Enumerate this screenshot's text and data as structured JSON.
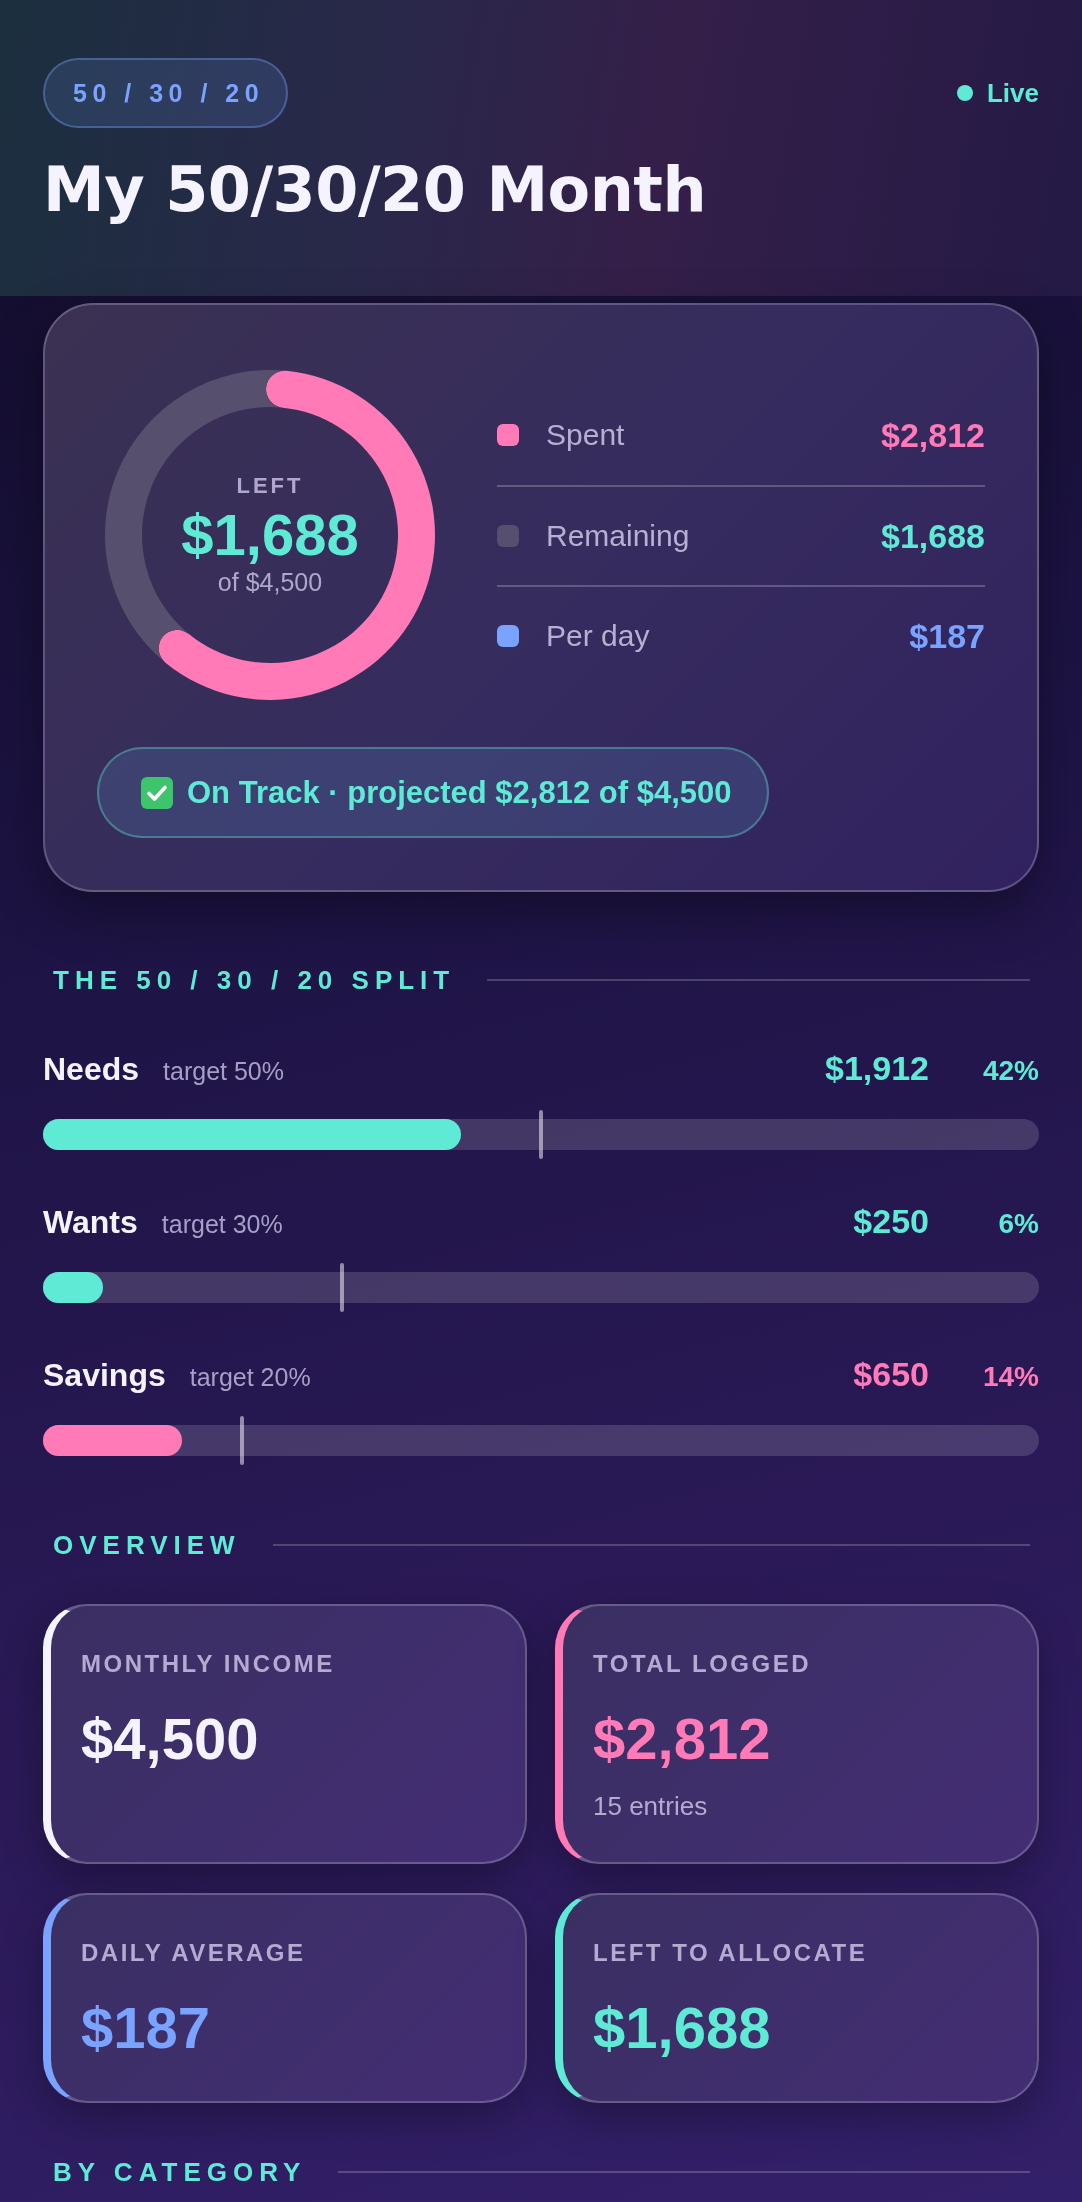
{
  "header": {
    "badge": "50 / 30 / 20",
    "status": "Live",
    "title": "My 50/30/20 Month"
  },
  "summary": {
    "ring": {
      "label": "LEFT",
      "value": "$1,688",
      "caption": "of $4,500",
      "chart_data": {
        "type": "donut",
        "values": [
          62.5,
          37.5
        ]
      }
    },
    "legend": [
      {
        "label": "Spent",
        "value": "$2,812",
        "color": "#ff7ab6",
        "kind": "spent"
      },
      {
        "label": "Remaining",
        "value": "$1,688",
        "color": "#56506e",
        "kind": "remaining"
      },
      {
        "label": "Per day",
        "value": "$187",
        "color": "#7aa2ff",
        "kind": "rate"
      }
    ],
    "badge": "On Track · projected $2,812 of $4,500"
  },
  "split": {
    "heading": "THE 50 / 30 / 20 SPLIT",
    "rows": [
      {
        "name": "Needs",
        "target": {
          "label": "target 50%",
          "level": 0.5
        },
        "amount": "$1,912",
        "percent": "42%",
        "level": 0.42,
        "color": "#5eead4"
      },
      {
        "name": "Wants",
        "target": {
          "label": "target 30%",
          "level": 0.3
        },
        "amount": "$250",
        "percent": "6%",
        "level": 0.06,
        "color": "#5eead4"
      },
      {
        "name": "Savings",
        "target": {
          "label": "target 20%",
          "level": 0.2
        },
        "amount": "$650",
        "percent": "14%",
        "level": 0.14,
        "color": "#ff7ab6"
      }
    ]
  },
  "overview": {
    "heading": "OVERVIEW",
    "cards": [
      {
        "label": "MONTHLY INCOME",
        "value": "$4,500",
        "color": "#f5f3ff"
      },
      {
        "label": "TOTAL LOGGED",
        "value": "$2,812",
        "note": "15 entries",
        "color": "#ff7ab6"
      },
      {
        "label": "DAILY AVERAGE",
        "value": "$187",
        "color": "#7aa2ff"
      },
      {
        "label": "LEFT TO ALLOCATE",
        "value": "$1,688",
        "color": "#5eead4"
      }
    ]
  },
  "by_category": {
    "heading": "BY CATEGORY"
  }
}
